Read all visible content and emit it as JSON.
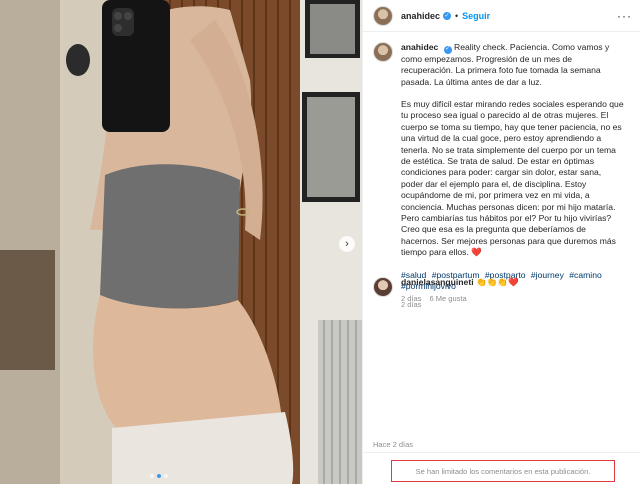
{
  "post": {
    "username": "anahidec",
    "follow_label": "Seguir",
    "separator": "•",
    "more_label": "···",
    "verified_mark": "✓"
  },
  "caption": {
    "username": "anahidec",
    "paragraph1": "Reality check. Paciencia. Como vamos y como empezamos. Progresión de un mes de recuperación. La primera foto fue tomada la semana pasada. La última antes de dar a luz.",
    "paragraph2": "Es muy difícil estar mirando redes sociales esperando que tu proceso sea igual o parecido al de otras mujeres. El cuerpo se toma su tiempo, hay que tener paciencia, no es una virtud de la cual goce, pero estoy aprendiendo a tenerla. No se trata simplemente del cuerpo por un tema de estética. Se trata de salud. De estar en óptimas condiciones para poder: cargar sin dolor, estar sana, poder dar el ejemplo para el, de disciplina. Estoy ocupándome de mi, por primera vez en mi vida, a conciencia. Muchas personas dicen: por mi hijo mataría. Pero cambiarías tus hábitos por el? Por tu hijo vivirías? Creo que esa es la pregunta que deberíamos de hacernos. Ser mejores personas para que duremos más tiempo para ellos. ❤️",
    "hashtags": [
      "#salud",
      "#postpartum",
      "#postparto",
      "#journey",
      "#camino",
      "#pormihijovivo"
    ],
    "time": "2 días"
  },
  "comment": {
    "username": "danielasanguineti",
    "text": "👏👏👏❤️",
    "time": "2 días",
    "likes": "6 Me gusta"
  },
  "footer": {
    "time_ago": "Hace 2 días",
    "limited_text": "Se han limitado los comentarios en esta publicación."
  },
  "carousel": {
    "next_icon": "chevron-right-icon",
    "next_glyph": "›",
    "dots": 3,
    "active_dot": 1
  },
  "colors": {
    "accent": "#0095f6",
    "verified": "#3897f0",
    "highlight_box": "#e0393e",
    "hashtag": "#00376b"
  }
}
